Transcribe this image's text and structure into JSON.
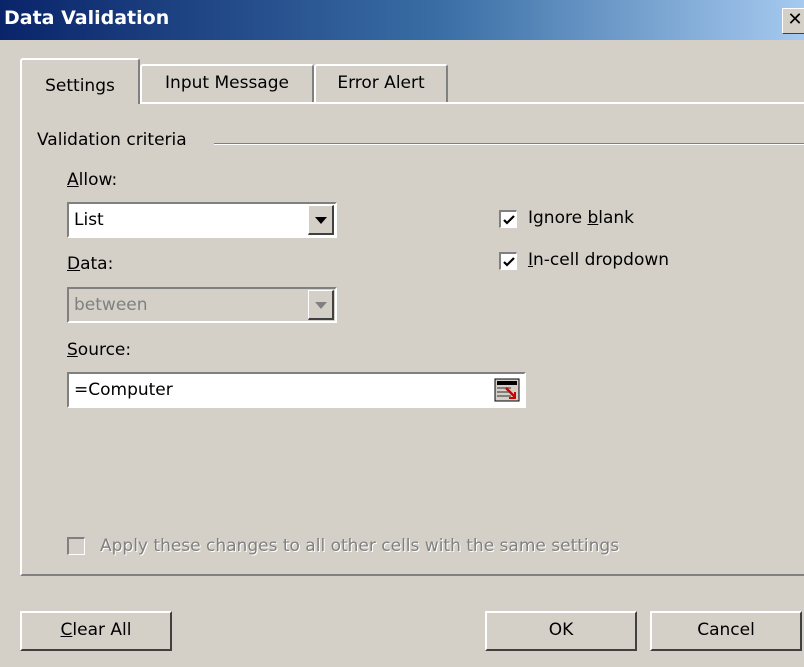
{
  "window": {
    "title": "Data Validation"
  },
  "tabs": [
    {
      "label": "Settings"
    },
    {
      "label": "Input Message"
    },
    {
      "label": "Error Alert"
    }
  ],
  "validation": {
    "section_label": "Validation criteria",
    "allow": {
      "label_accel": "A",
      "label_rest": "llow:",
      "value": "List"
    },
    "data": {
      "label_accel": "D",
      "label_rest": "ata:",
      "value": "between"
    },
    "source": {
      "label_accel": "S",
      "label_rest": "ource:",
      "value": "=Computer"
    },
    "ignore_blank": {
      "label_pre": "Ignore ",
      "label_accel": "b",
      "label_rest": "lank",
      "checked": true
    },
    "in_cell_dropdown": {
      "label_pre": "",
      "label_accel": "I",
      "label_rest": "n-cell dropdown",
      "checked": true
    },
    "apply_all": {
      "label": "Apply these changes to all other cells with the same settings",
      "checked": false
    }
  },
  "buttons": {
    "clear_all": {
      "accel": "C",
      "rest": "lear All"
    },
    "ok": "OK",
    "cancel": "Cancel"
  },
  "icons": {
    "close": "close-icon",
    "dropdown": "chevron-down-icon",
    "refedit": "range-select-icon",
    "check": "check-icon"
  }
}
